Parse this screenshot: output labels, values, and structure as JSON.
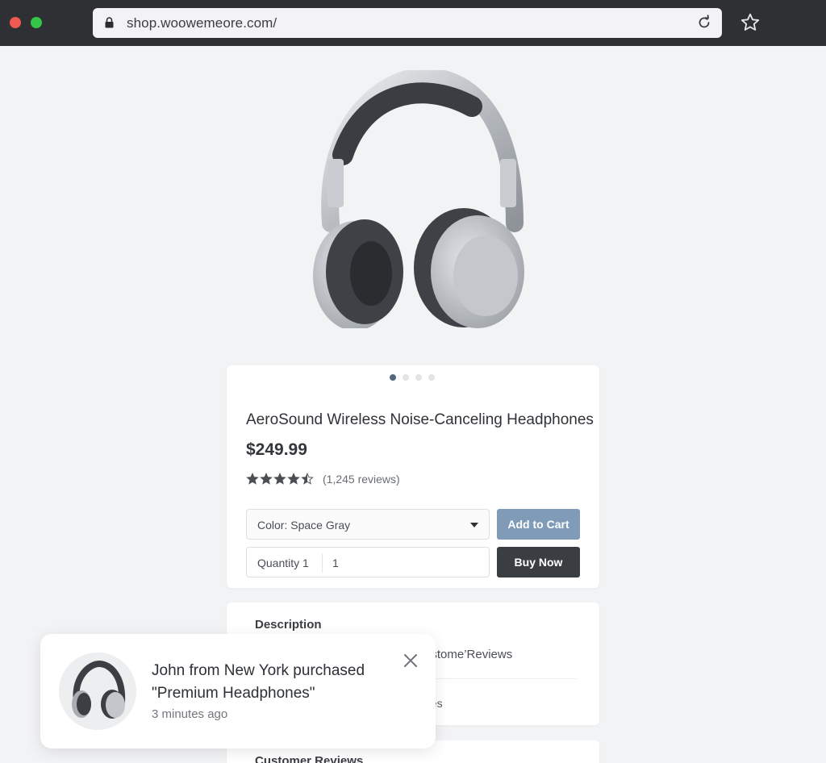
{
  "browser": {
    "url": "shop.woowemeore.com/"
  },
  "product": {
    "title": "AeroSound Wireless Noise-Canceling Headphones",
    "price": "$249.99",
    "rating": 4.5,
    "rating_max": 5,
    "reviews_text": "(1,245 reviews)",
    "carousel_dots": 4,
    "carousel_active": 1,
    "color_select": "Color: Space Gray",
    "quantity_label": "Quantity 1",
    "quantity_value": "1",
    "add_to_cart": "Add to Cart",
    "buy_now": "Buy Now"
  },
  "info": {
    "description_tab": "Description",
    "reviews_tab_partial": "ustome’Reviews",
    "line_partial": "ges"
  },
  "reviews_section": {
    "heading": "Customer Reviews"
  },
  "toast": {
    "message": "John from New York purchased \"Premium Headphones\"",
    "time": "3 minutes ago"
  },
  "colors": {
    "accent": "#7f9bb7",
    "dark_button": "#3a3e43",
    "chrome": "#2e3034"
  },
  "icons": [
    "lock-icon",
    "reload-icon",
    "star-bookmark-icon",
    "chevron-down-icon",
    "close-icon",
    "rating-star-icon"
  ]
}
